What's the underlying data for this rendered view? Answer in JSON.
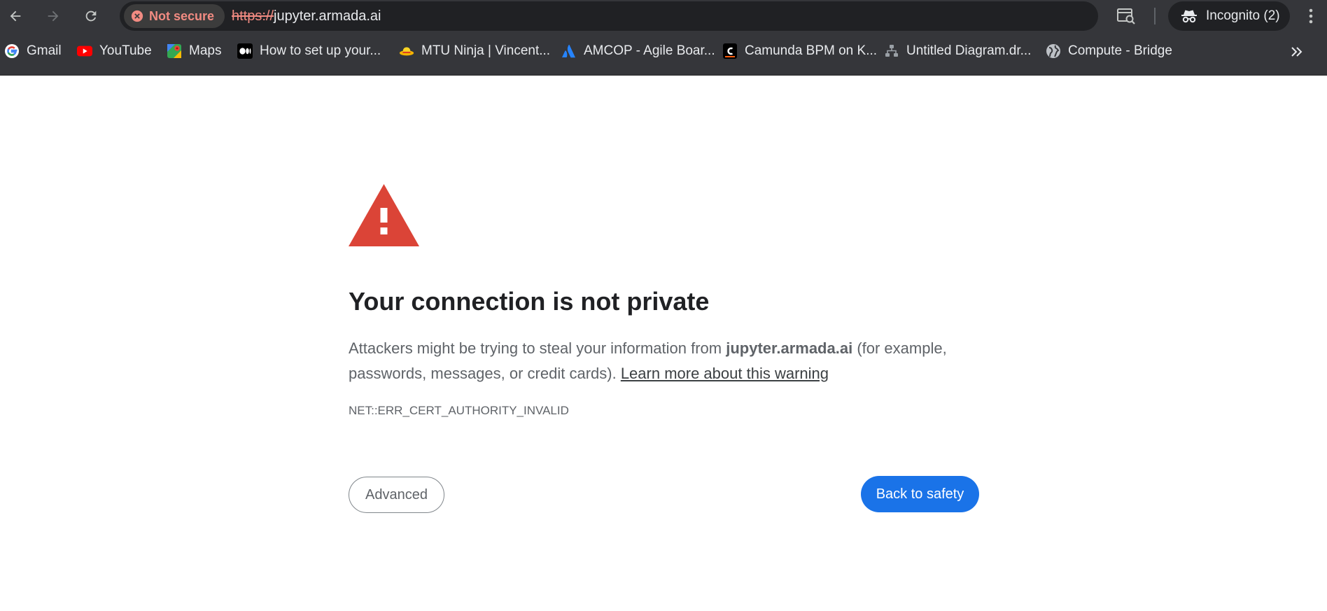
{
  "browser": {
    "security_chip": "Not secure",
    "url_scheme": "https://",
    "url_host": "jupyter.armada.ai",
    "incognito_label": "Incognito (2)"
  },
  "bookmarks": [
    {
      "label": "Gmail",
      "icon": "google-icon"
    },
    {
      "label": "YouTube",
      "icon": "youtube-icon"
    },
    {
      "label": "Maps",
      "icon": "maps-icon"
    },
    {
      "label": "How to set up your...",
      "icon": "medium-icon"
    },
    {
      "label": "MTU Ninja | Vincent...",
      "icon": "hat-icon"
    },
    {
      "label": "AMCOP - Agile Boar...",
      "icon": "atlassian-icon"
    },
    {
      "label": "Camunda BPM on K...",
      "icon": "camunda-icon"
    },
    {
      "label": "Untitled Diagram.dr...",
      "icon": "diagram-icon"
    },
    {
      "label": "Compute - Bridge",
      "icon": "globe-icon"
    }
  ],
  "page": {
    "heading": "Your connection is not private",
    "body_before": "Attackers might be trying to steal your information from ",
    "body_domain": "jupyter.armada.ai",
    "body_after": " (for example, passwords, messages, or credit cards). ",
    "learn_more": "Learn more about this warning",
    "error_code": "NET::ERR_CERT_AUTHORITY_INVALID",
    "advanced_label": "Advanced",
    "back_label": "Back to safety"
  },
  "colors": {
    "chrome_bg": "#35363a",
    "omnibox_bg": "#202124",
    "danger_red": "#f28b82",
    "warning_icon": "#db4437",
    "primary_blue": "#1a73e8"
  }
}
